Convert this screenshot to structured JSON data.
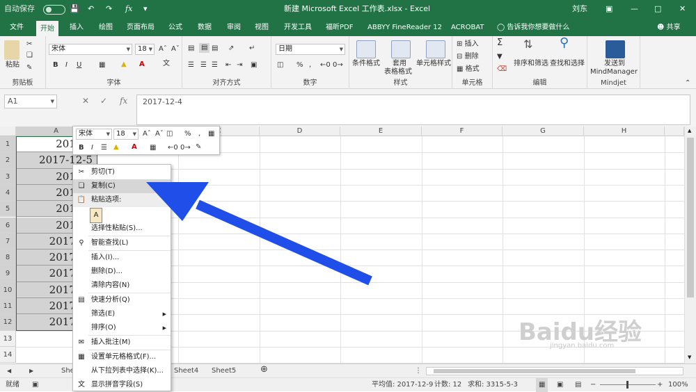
{
  "titlebar": {
    "autosave": "自动保存",
    "autosave_state": "关",
    "title": "新建 Microsoft Excel 工作表.xlsx - Excel",
    "user": "刘东"
  },
  "tabs": [
    "文件",
    "开始",
    "插入",
    "绘图",
    "页面布局",
    "公式",
    "数据",
    "审阅",
    "视图",
    "开发工具",
    "福昕PDF",
    "ABBYY FineReader 12",
    "ACROBAT"
  ],
  "tell_me": "告诉我你想要做什么",
  "share": "共享",
  "ribbon": {
    "clipboard": {
      "label": "剪贴板",
      "paste": "粘贴"
    },
    "font": {
      "label": "字体",
      "name": "宋体",
      "size": "18",
      "bold": "B",
      "italic": "I",
      "underline": "U"
    },
    "alignment": {
      "label": "对齐方式"
    },
    "number": {
      "label": "数字",
      "format": "日期",
      "percent": "%"
    },
    "styles": {
      "label": "样式",
      "conditional": "条件格式",
      "table1": "套用",
      "table2": "表格格式",
      "cell1": "单元格样式"
    },
    "cells": {
      "label": "单元格",
      "insert": "插入",
      "delete": "删除",
      "format": "格式"
    },
    "editing": {
      "label": "编辑",
      "sort": "排序和筛选",
      "find": "查找和选择"
    },
    "mindjet": {
      "label": "Mindjet",
      "send1": "发送到",
      "send2": "MindManager"
    }
  },
  "formula_bar": {
    "namebox": "A1",
    "fx": "fx",
    "value": "2017-12-4"
  },
  "columns": [
    "A",
    "B",
    "C",
    "D",
    "E",
    "F",
    "G",
    "H"
  ],
  "rows": [
    "1",
    "2",
    "3",
    "4",
    "5",
    "6",
    "7",
    "8",
    "9",
    "10",
    "11",
    "12",
    "13",
    "14"
  ],
  "cells_a": [
    "2017-1",
    "2017-12-5",
    "2017-1",
    "2017-1",
    "2017-1",
    "2017-1",
    "2017-12",
    "2017-12",
    "2017-12",
    "2017-12",
    "2017-12",
    "2017-12"
  ],
  "mini_toolbar": {
    "font": "宋体",
    "size": "18",
    "bold": "B",
    "italic": "I",
    "percent": "%",
    "comma": ","
  },
  "context_menu": {
    "cut": "剪切(T)",
    "copy": "复制(C)",
    "paste_options": "粘贴选项:",
    "paste_special": "选择性粘贴(S)...",
    "smart_lookup": "智能查找(L)",
    "insert": "插入(I)...",
    "delete": "删除(D)...",
    "clear": "清除内容(N)",
    "quick_analysis": "快速分析(Q)",
    "filter": "筛选(E)",
    "sort": "排序(O)",
    "comment": "插入批注(M)",
    "format_cells": "设置单元格格式(F)...",
    "pick_list": "从下拉列表中选择(K)...",
    "phonetic": "显示拼音字段(S)"
  },
  "sheets": [
    "She",
    "Sheet4",
    "Sheet5"
  ],
  "status": {
    "ready": "就绪",
    "average": "平均值: 2017-12-9",
    "count": "计数: 12",
    "sum": "求和: 3315-5-3",
    "zoom": "100%"
  },
  "watermark": {
    "brand": "Baidu经验",
    "url": "jingyan.baidu.com"
  },
  "colors": {
    "excel_green": "#217346",
    "arrow_blue": "#1f4fe8",
    "selection": "#d3d3d3"
  }
}
